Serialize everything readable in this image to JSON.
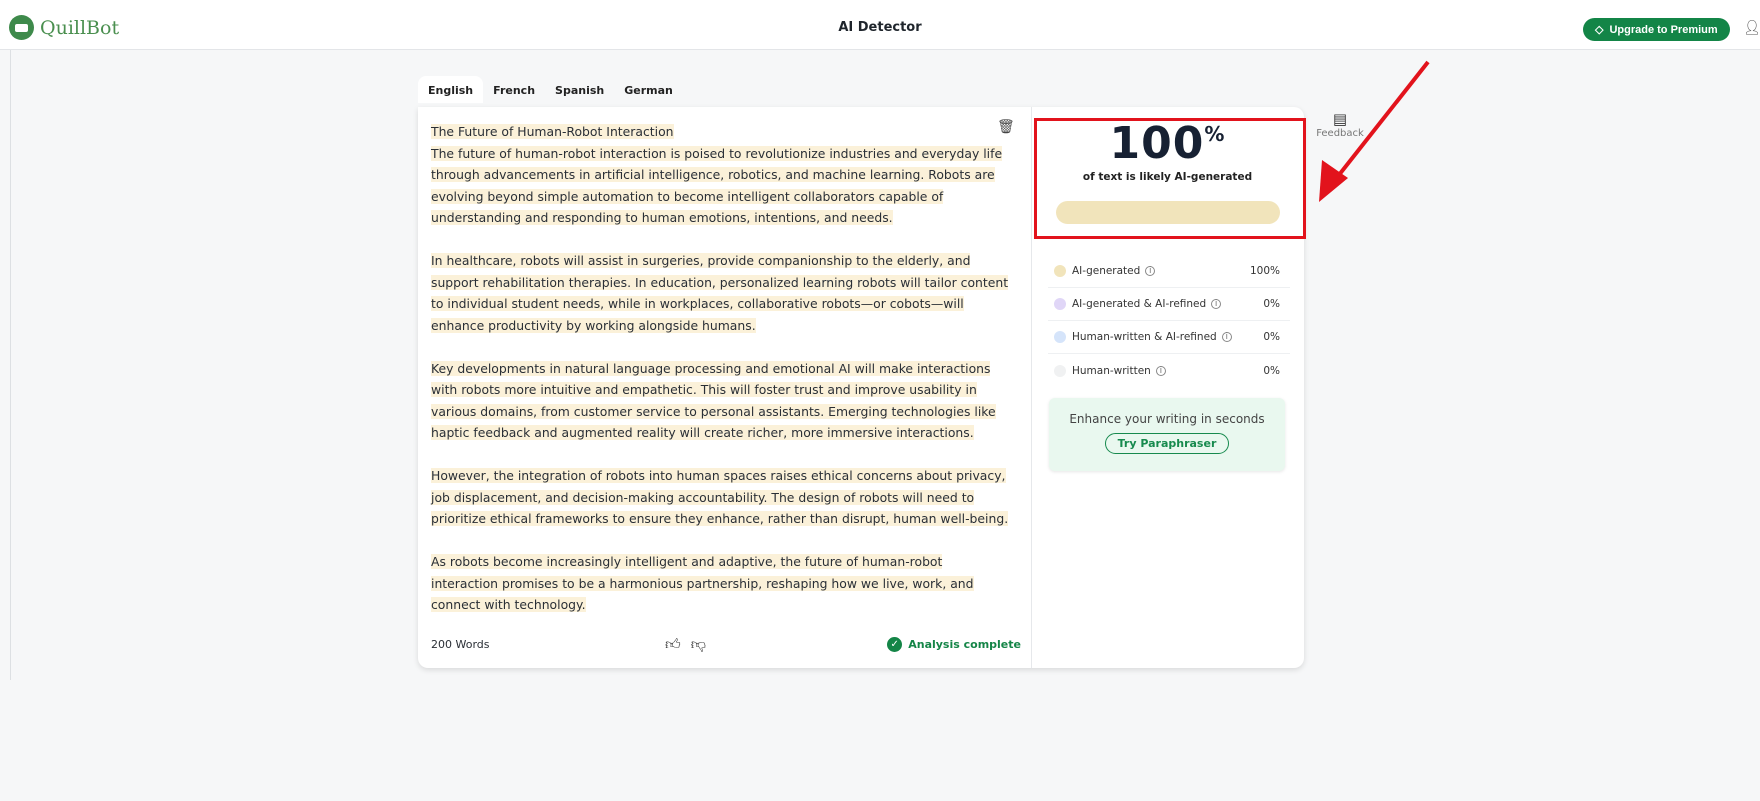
{
  "header": {
    "logo": "QuillBot",
    "title": "AI Detector",
    "upgrade": "Upgrade to Premium"
  },
  "tabs": [
    "English",
    "French",
    "Spanish",
    "German"
  ],
  "document": {
    "title": "The Future of Human-Robot Interaction",
    "paragraphs": [
      "The future of human-robot interaction is poised to revolutionize industries and everyday life through advancements in artificial intelligence, robotics, and machine learning. Robots are evolving beyond simple automation to become intelligent collaborators capable of understanding and responding to human emotions, intentions, and needs.",
      "In healthcare, robots will assist in surgeries, provide companionship to the elderly, and support rehabilitation therapies. In education, personalized learning robots will tailor content to individual student needs, while in workplaces, collaborative robots—or cobots—will enhance productivity by working alongside humans.",
      "Key developments in natural language processing and emotional AI will make interactions with robots more intuitive and empathetic. This will foster trust and improve usability in various domains, from customer service to personal assistants. Emerging technologies like haptic feedback and augmented reality will create richer, more immersive interactions.",
      "However, the integration of robots into human spaces raises ethical concerns about privacy, job displacement, and decision-making accountability. The design of robots will need to prioritize ethical frameworks to ensure they enhance, rather than disrupt, human well-being.",
      "As robots become increasingly intelligent and adaptive, the future of human-robot interaction promises to be a harmonious partnership, reshaping how we live, work, and connect with technology."
    ],
    "word_count": "200 Words",
    "status": "Analysis complete"
  },
  "result": {
    "score": "100",
    "percent_sign": "%",
    "subtitle": "of text is likely AI-generated",
    "ai_fraction": 1.0,
    "rows": [
      {
        "label": "AI-generated",
        "value": "100%",
        "color": "#f1e4bb"
      },
      {
        "label": "AI-generated & AI-refined",
        "value": "0%",
        "color": "#e0d6f7"
      },
      {
        "label": "Human-written & AI-refined",
        "value": "0%",
        "color": "#d5e4fa"
      },
      {
        "label": "Human-written",
        "value": "0%",
        "color": "#f0f1f2"
      }
    ]
  },
  "promo": {
    "text": "Enhance your writing in seconds",
    "button": "Try Paraphraser"
  },
  "feedback": "Feedback"
}
